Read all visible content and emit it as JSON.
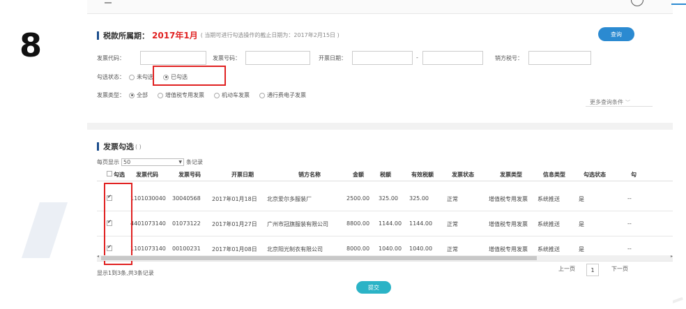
{
  "step_number": "8",
  "query_section": {
    "title": "税款所属期：",
    "period": "2017年1月",
    "note": "( 当期可进行勾选操作的截止日期为：2017年2月15日 )",
    "query_button": "查询",
    "fields": {
      "invoice_code_label": "发票代码：",
      "invoice_number_label": "发票号码：",
      "issue_date_label": "开票日期：",
      "date_separator": "-",
      "seller_tax_label": "销方税号："
    },
    "select_status": {
      "label": "勾选状态：",
      "options": [
        "未勾选",
        "已勾选"
      ],
      "selected": "已勾选"
    },
    "invoice_type": {
      "label": "发票类型：",
      "options": [
        "全部",
        "增值税专用发票",
        "机动车发票",
        "通行费电子发票"
      ],
      "selected": "全部"
    },
    "more_conditions": "更多查询条件"
  },
  "table_section": {
    "title": "发票勾选",
    "title_suffix": "( )",
    "per_page_label": "每页显示",
    "per_page_value": "50",
    "per_page_unit": "条记录",
    "columns": [
      "勾选",
      "发票代码",
      "发票号码",
      "开票日期",
      "销方名称",
      "金额",
      "税额",
      "有效税额",
      "发票状态",
      "发票类型",
      "信息类型",
      "勾选状态",
      "勾"
    ],
    "rows": [
      {
        "checked": true,
        "code": "1101030040",
        "number": "30040568",
        "date": "2017年01月18日",
        "seller": "北京爱尔多服装厂",
        "amount": "2500.00",
        "tax": "325.00",
        "valid_tax": "325.00",
        "status": "正常",
        "type": "增值税专用发票",
        "info": "系统推送",
        "sel": "是",
        "extra": "--"
      },
      {
        "checked": true,
        "code": "4401073140",
        "number": "01073122",
        "date": "2017年01月27日",
        "seller": "广州市冠旗服装有限公司",
        "amount": "8800.00",
        "tax": "1144.00",
        "valid_tax": "1144.00",
        "status": "正常",
        "type": "增值税专用发票",
        "info": "系统推送",
        "sel": "是",
        "extra": "--"
      },
      {
        "checked": true,
        "code": "1101073140",
        "number": "00100231",
        "date": "2017年01月08日",
        "seller": "北京阳光制衣有限公司",
        "amount": "8000.00",
        "tax": "1040.00",
        "valid_tax": "1040.00",
        "status": "正常",
        "type": "增值税专用发票",
        "info": "系统推送",
        "sel": "是",
        "extra": "--"
      }
    ],
    "summary": "显示1到3条,共3条记录",
    "prev": "上一页",
    "page": "1",
    "next": "下一页",
    "submit": "提交"
  },
  "colors": {
    "accent": "#2b8ad1",
    "highlight_red": "#e02020",
    "submit": "#2bb3c6"
  }
}
